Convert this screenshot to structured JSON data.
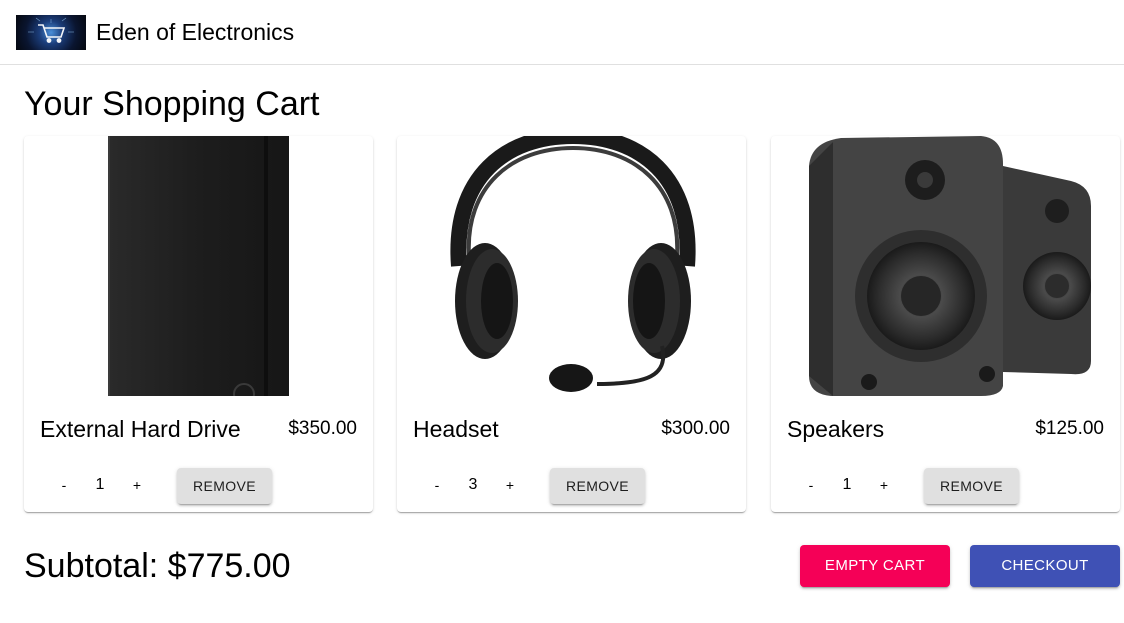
{
  "header": {
    "brand": "Eden of Electronics",
    "logo_icon": "shopping-cart-icon"
  },
  "page": {
    "title": "Your Shopping Cart"
  },
  "cart": {
    "items": [
      {
        "name": "External Hard Drive",
        "price": "$350.00",
        "quantity": "1",
        "decrement": "-",
        "increment": "+",
        "remove_label": "REMOVE",
        "image": "external-hard-drive-image"
      },
      {
        "name": "Headset",
        "price": "$300.00",
        "quantity": "3",
        "decrement": "-",
        "increment": "+",
        "remove_label": "REMOVE",
        "image": "headset-image"
      },
      {
        "name": "Speakers",
        "price": "$125.00",
        "quantity": "1",
        "decrement": "-",
        "increment": "+",
        "remove_label": "REMOVE",
        "image": "speakers-image"
      }
    ]
  },
  "footer": {
    "subtotal": "Subtotal: $775.00",
    "empty_cart_label": "EMPTY CART",
    "checkout_label": "CHECKOUT"
  },
  "colors": {
    "empty_cart": "#f50057",
    "checkout": "#3f51b5",
    "remove_button": "#e0e0e0"
  }
}
